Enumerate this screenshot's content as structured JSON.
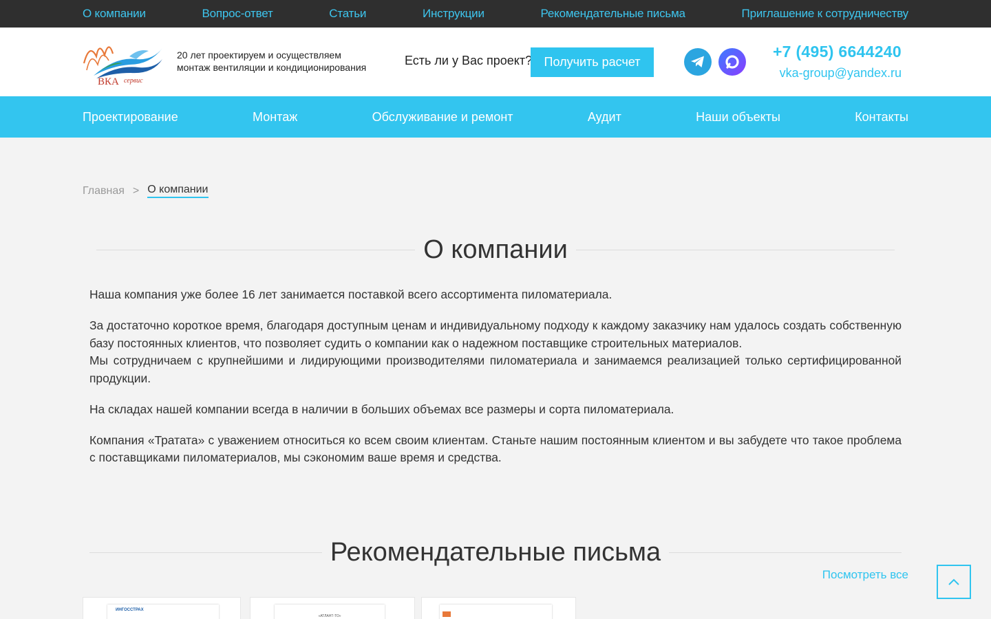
{
  "topbar": {
    "items": [
      "О компании",
      "Вопрос-ответ",
      "Статьи",
      "Инструкции",
      "Рекомендательные письма",
      "Приглашение к сотрудничеству"
    ]
  },
  "header": {
    "logo_text": "ВКА",
    "logo_subtext": "сервис",
    "tagline_line1": "20 лет проектируем и осуществляем",
    "tagline_line2": "монтаж вентиляции и кондиционирования",
    "project_question": "Есть ли у Вас проект?",
    "cta_label": "Получить расчет",
    "phone": "+7 (495) 6644240",
    "email": "vka-group@yandex.ru",
    "social_icons": [
      "telegram-icon",
      "max-messenger-icon"
    ]
  },
  "mainnav": {
    "items": [
      "Проектирование",
      "Монтаж",
      "Обслуживание и ремонт",
      "Аудит",
      "Наши объекты",
      "Контакты"
    ]
  },
  "breadcrumb": {
    "home": "Главная",
    "separator": ">",
    "current": "О компании"
  },
  "about": {
    "title": "О компании",
    "paragraphs": [
      "Наша компания уже более 16 лет занимается поставкой всего ассортимента пиломатериала.",
      "За достаточно короткое время, благодаря доступным ценам и индивидуальному подходу к каждому заказчику нам удалось создать собственную базу постоянных клиентов, что позволяет судить о компании как о надежном поставщике строительных материалов.",
      "Мы сотрудничаем с крупнейшими и лидирующими производителями пиломатериала и занимаемся реализацией только сертифицированной продукции.",
      "На складах нашей компании всегда в наличии в больших объемах все размеры и сорта пиломатериала.",
      "Компания «Тратата» с уважением относиться ко всем своим клиентам. Станьте нашим постоянным клиентом и вы забудете что такое проблема с поставщиками пиломатериалов, мы сэкономим ваше время и средства."
    ]
  },
  "letters": {
    "title": "Рекомендательные письма",
    "see_all": "Посмотреть все",
    "thumbs": [
      "ИНГОССТРАХ",
      "«АТЛАНТ-ТО»",
      ""
    ]
  },
  "colors": {
    "accent": "#2fc4ef",
    "topbar_bg": "#2f2f2f",
    "nav_bg": "#33c5ef",
    "page_bg": "#f3f3f3"
  }
}
